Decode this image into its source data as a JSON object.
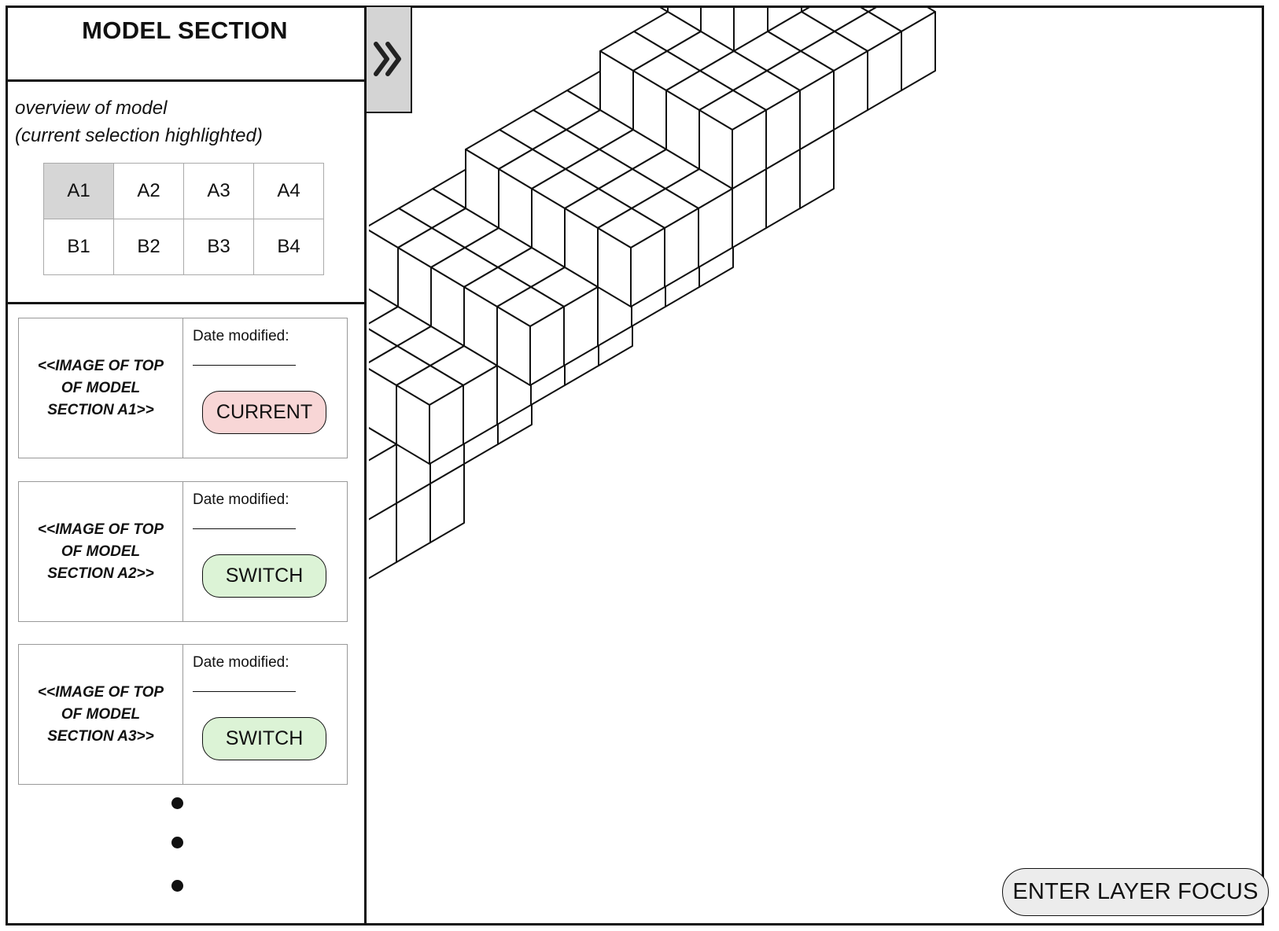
{
  "sidebar": {
    "title": "MODEL SECTION",
    "overview_caption_line1": "overview of model",
    "overview_caption_line2": "(current selection highlighted)",
    "grid": [
      [
        "A1",
        "A2",
        "A3",
        "A4"
      ],
      [
        "B1",
        "B2",
        "B3",
        "B4"
      ]
    ],
    "selected_cell": "A1",
    "cards": [
      {
        "image_text_1": "<<IMAGE OF TOP",
        "image_text_2": "OF MODEL",
        "image_text_3": "SECTION A1>>",
        "date_label": "Date modified:",
        "button_label": "CURRENT",
        "button_kind": "current"
      },
      {
        "image_text_1": "<<IMAGE OF TOP",
        "image_text_2": "OF MODEL",
        "image_text_3": "SECTION A2>>",
        "date_label": "Date modified:",
        "button_label": "SWITCH",
        "button_kind": "switch"
      },
      {
        "image_text_1": "<<IMAGE OF TOP",
        "image_text_2": "OF MODEL",
        "image_text_3": "SECTION A3>>",
        "date_label": "Date modified:",
        "button_label": "SWITCH",
        "button_kind": "switch"
      }
    ]
  },
  "expand_tab": {
    "icon": "double-chevron-right-icon"
  },
  "main": {
    "layer_focus_button": "ENTER LAYER FOCUS"
  },
  "colors": {
    "selected_cell": "#d6d6d6",
    "current_button": "#f8d6d6",
    "switch_button": "#dcf3d6",
    "tab_bg": "#d4d4d4",
    "layer_button_bg": "#ececec"
  }
}
